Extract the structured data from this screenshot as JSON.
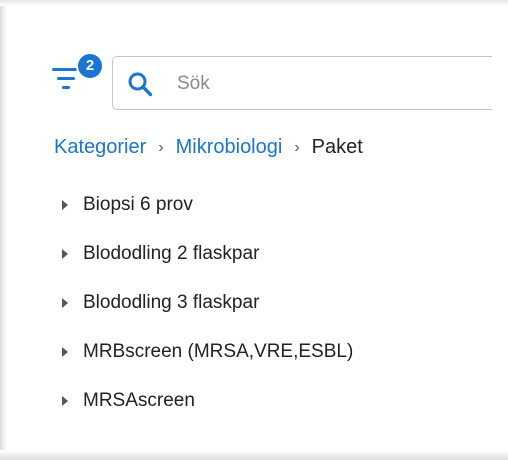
{
  "filter": {
    "icon": "filter-list-icon",
    "badge_count": "2",
    "accent_color": "#1976d2"
  },
  "search": {
    "icon": "search-icon",
    "placeholder": "Sök",
    "value": ""
  },
  "breadcrumb": {
    "items": [
      "Kategorier",
      "Mikrobiologi"
    ],
    "separator": "›",
    "current": "Paket"
  },
  "tree": {
    "items": [
      {
        "label": "Biopsi 6 prov",
        "icon": "caret-right-icon"
      },
      {
        "label": "Blododling 2 flaskpar",
        "icon": "caret-right-icon"
      },
      {
        "label": "Blododling 3 flaskpar",
        "icon": "caret-right-icon"
      },
      {
        "label": "MRBscreen (MRSA,VRE,ESBL)",
        "icon": "caret-right-icon"
      },
      {
        "label": "MRSAscreen",
        "icon": "caret-right-icon"
      }
    ]
  }
}
